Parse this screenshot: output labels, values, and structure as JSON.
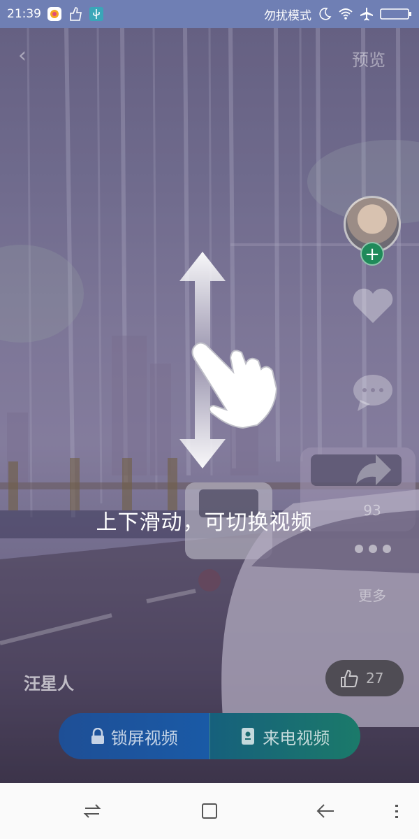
{
  "status_bar": {
    "time": "21:39",
    "dnd_label": "勿扰模式",
    "icons": [
      "app-photos-icon",
      "thumb-icon",
      "usb-icon",
      "moon-icon",
      "wifi-icon",
      "airplane-icon",
      "battery-icon"
    ]
  },
  "header": {
    "back_glyph": "‹",
    "preview_label": "预览"
  },
  "rail": {
    "follow_glyph": "+",
    "comment_count": "93",
    "more_label": "更多"
  },
  "hint": {
    "text": "上下滑动，可切换视频"
  },
  "video": {
    "author": "汪星人",
    "like_count": "27"
  },
  "actions": {
    "lock_label": "锁屏视频",
    "call_label": "来电视频"
  },
  "colors": {
    "status_bar": "#6f7fb4",
    "lock_button": "#1e4f96",
    "call_button": "#1b7a6a",
    "follow": "#1f8a5a"
  }
}
